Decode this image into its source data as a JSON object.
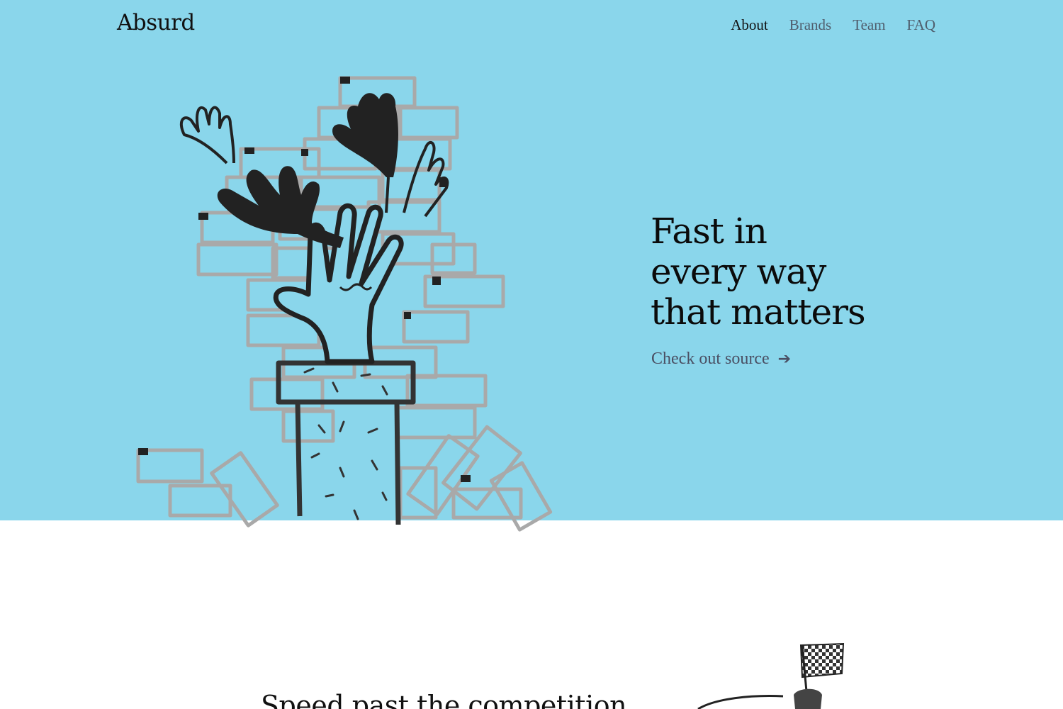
{
  "header": {
    "logo": "Absurd",
    "nav": [
      {
        "label": "About",
        "active": true
      },
      {
        "label": "Brands",
        "active": false
      },
      {
        "label": "Team",
        "active": false
      },
      {
        "label": "FAQ",
        "active": false
      }
    ]
  },
  "hero": {
    "headline_lines": [
      "Fast in",
      "every way",
      "that matters"
    ],
    "cta_label": "Check out source",
    "cta_icon": "arrow-right-icon",
    "illustration": "hands-reaching-over-brick-wall-illustration"
  },
  "section2": {
    "heading": "Speed past the competition",
    "illustration": "checkered-flag-illustration"
  },
  "colors": {
    "hero_background": "#8ad6eb",
    "page_background": "#ffffff",
    "text": "#111111",
    "nav_inactive": "#4f5d6c",
    "cta": "#4a4f63",
    "brick_outline": "#a8a8a8"
  }
}
